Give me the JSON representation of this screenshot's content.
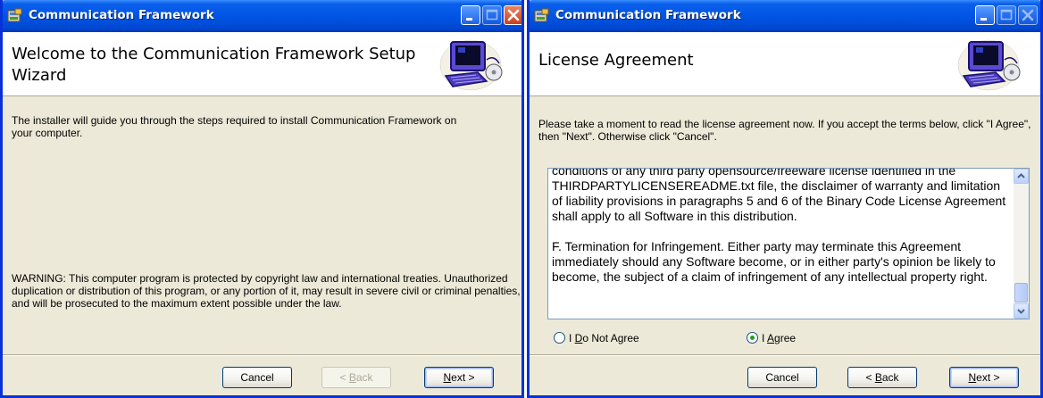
{
  "windows": [
    {
      "title": "Communication Framework",
      "header_title": "Welcome to the Communication Framework Setup Wizard",
      "intro": "The installer will guide you through the steps required to install Communication Framework on your computer.",
      "warning": "WARNING: This computer program is protected by copyright law and international treaties. Unauthorized duplication or distribution of this program, or any portion of it, may result in severe civil or criminal penalties, and will be prosecuted to the maximum extent possible under the law.",
      "buttons": {
        "cancel": "Cancel",
        "back_pre": "< ",
        "back_key": "B",
        "back_post": "ack",
        "next_key": "N",
        "next_post": "ext >"
      },
      "back_enabled": false
    },
    {
      "title": "Communication Framework",
      "header_title": "License Agreement",
      "intro": "Please take a moment to read the license agreement now. If you accept the terms below, click \"I Agree\", then \"Next\". Otherwise click \"Cancel\".",
      "license_paragraphs": [
        "conditions of any third party opensource/freeware license identified in the THIRDPARTYLICENSEREADME.txt file, the disclaimer of warranty and limitation of liability provisions in paragraphs 5 and 6 of the Binary Code License Agreement shall apply to all Software in this distribution.",
        "F.  Termination for Infringement.  Either party may terminate this Agreement immediately should any Software become, or in either party's opinion be likely to become, the subject of a claim of infringement of any intellectual property right."
      ],
      "radio_options": {
        "do_not_agree_pre": "I ",
        "do_not_agree_key": "D",
        "do_not_agree_post": "o Not Agree",
        "agree_pre": "I ",
        "agree_key": "A",
        "agree_post": "gree",
        "selected": "agree"
      },
      "buttons": {
        "cancel": "Cancel",
        "back_pre": "< ",
        "back_key": "B",
        "back_post": "ack",
        "next_key": "N",
        "next_post": "ext >"
      },
      "back_enabled": true
    }
  ],
  "colors": {
    "titlebar": "#0055e5",
    "dialog_face": "#ece9d8",
    "window_border": "#0831d9",
    "close_button": "#c84020"
  },
  "icons": [
    "setup-icon",
    "minimize-icon",
    "maximize-icon",
    "close-icon",
    "computer-logo",
    "scroll-up-icon",
    "scroll-down-icon"
  ]
}
